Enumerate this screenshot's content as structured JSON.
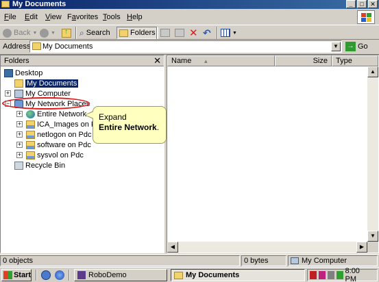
{
  "window": {
    "title": "My Documents",
    "buttons": {
      "minimize": "_",
      "maximize": "□",
      "close": "✕"
    }
  },
  "menu": {
    "items": [
      {
        "label": "File",
        "underline": "F",
        "rest": "ile"
      },
      {
        "label": "Edit",
        "underline": "E",
        "rest": "dit"
      },
      {
        "label": "View",
        "underline": "V",
        "rest": "iew"
      },
      {
        "label": "Favorites",
        "underline": "a",
        "pre": "F",
        "rest": "vorites"
      },
      {
        "label": "Tools",
        "underline": "T",
        "rest": "ools"
      },
      {
        "label": "Help",
        "underline": "H",
        "rest": "elp"
      }
    ]
  },
  "toolbar": {
    "back_label": "Back",
    "search_label": "Search",
    "folders_label": "Folders"
  },
  "address": {
    "label": "Address",
    "value": "My Documents",
    "go_label": "Go"
  },
  "folders_pane": {
    "title": "Folders",
    "close": "✕",
    "tree": [
      {
        "label": "Desktop",
        "icon": "desktop-icon",
        "expander": ""
      },
      {
        "label": "My Documents",
        "icon": "folder-icon",
        "expander": "",
        "selected": true
      },
      {
        "label": "My Computer",
        "icon": "computer-icon",
        "expander": "+"
      },
      {
        "label": "My Network Places",
        "icon": "network-places-icon",
        "expander": "−"
      },
      {
        "label": "Entire Network",
        "icon": "globe-icon",
        "expander": "+"
      },
      {
        "label": "ICA_Images on Pdc",
        "icon": "network-share-icon",
        "expander": "+"
      },
      {
        "label": "netlogon on Pdc",
        "icon": "network-share-icon",
        "expander": "+"
      },
      {
        "label": "software on Pdc",
        "icon": "network-share-icon",
        "expander": "+"
      },
      {
        "label": "sysvol on Pdc",
        "icon": "network-share-icon",
        "expander": "+"
      },
      {
        "label": "Recycle Bin",
        "icon": "recycle-bin-icon",
        "expander": ""
      }
    ]
  },
  "callout": {
    "line1": "Expand",
    "line2_bold": "Entire Network",
    "line2_suffix": "."
  },
  "file_list": {
    "columns": [
      "Name",
      "Size",
      "Type"
    ],
    "rows": []
  },
  "status_bar": {
    "objects": "0 objects",
    "size": "0 bytes",
    "location": "My Computer"
  },
  "taskbar": {
    "start_label": "Start",
    "tasks": [
      {
        "label": "RoboDemo",
        "active": false
      },
      {
        "label": "My Documents",
        "active": true
      }
    ],
    "clock": "8:00 PM"
  },
  "colors": {
    "titlebar": "#0a246a",
    "selection": "#0a246a",
    "callout_bg": "#ffffc0",
    "highlight_ring": "#e01818"
  }
}
